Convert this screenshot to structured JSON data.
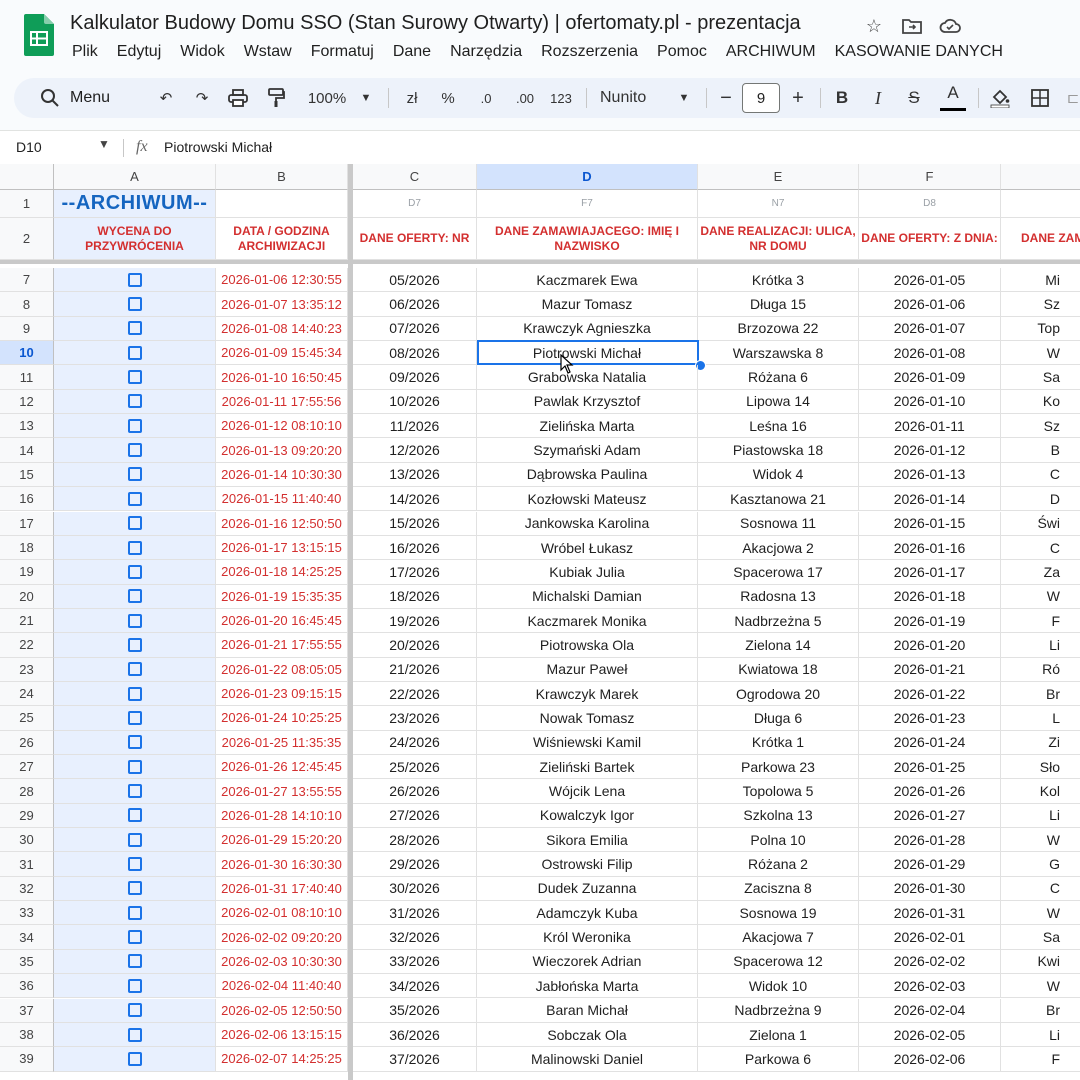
{
  "app": {
    "doc_title": "Kalkulator Budowy Domu SSO (Stan Surowy Otwarty) | ofertomaty.pl - prezentacja",
    "menu": [
      "Plik",
      "Edytuj",
      "Widok",
      "Wstaw",
      "Formatuj",
      "Dane",
      "Narzędzia",
      "Rozszerzenia",
      "Pomoc",
      "ARCHIWUM",
      "KASOWANIE DANYCH"
    ],
    "title_icons": [
      "star-icon",
      "move-to-folder-icon",
      "cloud-status-icon"
    ]
  },
  "toolbar": {
    "menu_search": "Menu",
    "zoom": "100%",
    "currency": "zł",
    "percent": "%",
    "dec_decrease": ".0",
    "dec_increase": ".00",
    "number_format": "123",
    "font": "Nunito",
    "font_size": "9",
    "minus": "−",
    "plus": "+",
    "bold": "B",
    "italic": "I",
    "strike": "S",
    "text_color": "A"
  },
  "formula_bar": {
    "name_box": "D10",
    "fx": "fx",
    "content": "Piotrowski Michał"
  },
  "columns": [
    "A",
    "B",
    "C",
    "D",
    "E",
    "F"
  ],
  "header_rows": {
    "row1": {
      "num": "1",
      "archive_title": "--ARCHIWUM--",
      "c": "D7",
      "d": "F7",
      "e": "N7",
      "f": "D8"
    },
    "row2": {
      "num": "2",
      "a": "WYCENA DO PRZYWRÓCENIA",
      "b": "DATA / GODZINA ARCHIWIZACJI",
      "c": "DANE OFERTY: NR",
      "d": "DANE ZAMAWIAJACEGO: IMIĘ I NAZWISKO",
      "e": "DANE REALIZACJI: ULICA, NR DOMU",
      "f": "DANE OFERTY: Z DNIA:",
      "g": "DANE ZAM"
    }
  },
  "rows": [
    {
      "num": "7",
      "b": "2026-01-06 12:30:55",
      "c": "05/2026",
      "d": "Kaczmarek Ewa",
      "e": "Krótka 3",
      "f": "2026-01-05",
      "g": "Mi"
    },
    {
      "num": "8",
      "b": "2026-01-07 13:35:12",
      "c": "06/2026",
      "d": "Mazur Tomasz",
      "e": "Długa 15",
      "f": "2026-01-06",
      "g": "Sz"
    },
    {
      "num": "9",
      "b": "2026-01-08 14:40:23",
      "c": "07/2026",
      "d": "Krawczyk Agnieszka",
      "e": "Brzozowa 22",
      "f": "2026-01-07",
      "g": "Top"
    },
    {
      "num": "10",
      "b": "2026-01-09 15:45:34",
      "c": "08/2026",
      "d": "Piotrowski Michał",
      "e": "Warszawska 8",
      "f": "2026-01-08",
      "g": "W"
    },
    {
      "num": "11",
      "b": "2026-01-10 16:50:45",
      "c": "09/2026",
      "d": "Grabowska Natalia",
      "e": "Różana 6",
      "f": "2026-01-09",
      "g": "Sa"
    },
    {
      "num": "12",
      "b": "2026-01-11 17:55:56",
      "c": "10/2026",
      "d": "Pawlak Krzysztof",
      "e": "Lipowa 14",
      "f": "2026-01-10",
      "g": "Ko"
    },
    {
      "num": "13",
      "b": "2026-01-12 08:10:10",
      "c": "11/2026",
      "d": "Zielińska Marta",
      "e": "Leśna 16",
      "f": "2026-01-11",
      "g": "Sz"
    },
    {
      "num": "14",
      "b": "2026-01-13 09:20:20",
      "c": "12/2026",
      "d": "Szymański Adam",
      "e": "Piastowska 18",
      "f": "2026-01-12",
      "g": "B"
    },
    {
      "num": "15",
      "b": "2026-01-14 10:30:30",
      "c": "13/2026",
      "d": "Dąbrowska Paulina",
      "e": "Widok 4",
      "f": "2026-01-13",
      "g": "C"
    },
    {
      "num": "16",
      "b": "2026-01-15 11:40:40",
      "c": "14/2026",
      "d": "Kozłowski Mateusz",
      "e": "Kasztanowa 21",
      "f": "2026-01-14",
      "g": "D"
    },
    {
      "num": "17",
      "b": "2026-01-16 12:50:50",
      "c": "15/2026",
      "d": "Jankowska Karolina",
      "e": "Sosnowa 11",
      "f": "2026-01-15",
      "g": "Świ"
    },
    {
      "num": "18",
      "b": "2026-01-17 13:15:15",
      "c": "16/2026",
      "d": "Wróbel Łukasz",
      "e": "Akacjowa 2",
      "f": "2026-01-16",
      "g": "C"
    },
    {
      "num": "19",
      "b": "2026-01-18 14:25:25",
      "c": "17/2026",
      "d": "Kubiak Julia",
      "e": "Spacerowa 17",
      "f": "2026-01-17",
      "g": "Za"
    },
    {
      "num": "20",
      "b": "2026-01-19 15:35:35",
      "c": "18/2026",
      "d": "Michalski Damian",
      "e": "Radosna 13",
      "f": "2026-01-18",
      "g": "W"
    },
    {
      "num": "21",
      "b": "2026-01-20 16:45:45",
      "c": "19/2026",
      "d": "Kaczmarek Monika",
      "e": "Nadbrzeżna 5",
      "f": "2026-01-19",
      "g": "F"
    },
    {
      "num": "22",
      "b": "2026-01-21 17:55:55",
      "c": "20/2026",
      "d": "Piotrowska Ola",
      "e": "Zielona 14",
      "f": "2026-01-20",
      "g": "Li"
    },
    {
      "num": "23",
      "b": "2026-01-22 08:05:05",
      "c": "21/2026",
      "d": "Mazur Paweł",
      "e": "Kwiatowa 18",
      "f": "2026-01-21",
      "g": "Ró"
    },
    {
      "num": "24",
      "b": "2026-01-23 09:15:15",
      "c": "22/2026",
      "d": "Krawczyk Marek",
      "e": "Ogrodowa 20",
      "f": "2026-01-22",
      "g": "Br"
    },
    {
      "num": "25",
      "b": "2026-01-24 10:25:25",
      "c": "23/2026",
      "d": "Nowak Tomasz",
      "e": "Długa 6",
      "f": "2026-01-23",
      "g": "L"
    },
    {
      "num": "26",
      "b": "2026-01-25 11:35:35",
      "c": "24/2026",
      "d": "Wiśniewski Kamil",
      "e": "Krótka 1",
      "f": "2026-01-24",
      "g": "Zi"
    },
    {
      "num": "27",
      "b": "2026-01-26 12:45:45",
      "c": "25/2026",
      "d": "Zieliński Bartek",
      "e": "Parkowa 23",
      "f": "2026-01-25",
      "g": "Sło"
    },
    {
      "num": "28",
      "b": "2026-01-27 13:55:55",
      "c": "26/2026",
      "d": "Wójcik Lena",
      "e": "Topolowa 5",
      "f": "2026-01-26",
      "g": "Kol"
    },
    {
      "num": "29",
      "b": "2026-01-28 14:10:10",
      "c": "27/2026",
      "d": "Kowalczyk Igor",
      "e": "Szkolna 13",
      "f": "2026-01-27",
      "g": "Li"
    },
    {
      "num": "30",
      "b": "2026-01-29 15:20:20",
      "c": "28/2026",
      "d": "Sikora Emilia",
      "e": "Polna 10",
      "f": "2026-01-28",
      "g": "W"
    },
    {
      "num": "31",
      "b": "2026-01-30 16:30:30",
      "c": "29/2026",
      "d": "Ostrowski Filip",
      "e": "Różana 2",
      "f": "2026-01-29",
      "g": "G"
    },
    {
      "num": "32",
      "b": "2026-01-31 17:40:40",
      "c": "30/2026",
      "d": "Dudek Zuzanna",
      "e": "Zaciszna 8",
      "f": "2026-01-30",
      "g": "C"
    },
    {
      "num": "33",
      "b": "2026-02-01 08:10:10",
      "c": "31/2026",
      "d": "Adamczyk Kuba",
      "e": "Sosnowa 19",
      "f": "2026-01-31",
      "g": "W"
    },
    {
      "num": "34",
      "b": "2026-02-02 09:20:20",
      "c": "32/2026",
      "d": "Król Weronika",
      "e": "Akacjowa 7",
      "f": "2026-02-01",
      "g": "Sa"
    },
    {
      "num": "35",
      "b": "2026-02-03 10:30:30",
      "c": "33/2026",
      "d": "Wieczorek Adrian",
      "e": "Spacerowa 12",
      "f": "2026-02-02",
      "g": "Kwi"
    },
    {
      "num": "36",
      "b": "2026-02-04 11:40:40",
      "c": "34/2026",
      "d": "Jabłońska Marta",
      "e": "Widok 10",
      "f": "2026-02-03",
      "g": "W"
    },
    {
      "num": "37",
      "b": "2026-02-05 12:50:50",
      "c": "35/2026",
      "d": "Baran Michał",
      "e": "Nadbrzeżna 9",
      "f": "2026-02-04",
      "g": "Br"
    },
    {
      "num": "38",
      "b": "2026-02-06 13:15:15",
      "c": "36/2026",
      "d": "Sobczak Ola",
      "e": "Zielona 1",
      "f": "2026-02-05",
      "g": "Li"
    },
    {
      "num": "39",
      "b": "2026-02-07 14:25:25",
      "c": "37/2026",
      "d": "Malinowski Daniel",
      "e": "Parkowa 6",
      "f": "2026-02-06",
      "g": "F"
    }
  ],
  "selected": {
    "row": "10",
    "col": "D"
  },
  "colors": {
    "accent": "#1a73e8",
    "header_red": "#d32f2f",
    "archive_blue": "#1565c0",
    "selection_bg": "#d3e3fd"
  }
}
